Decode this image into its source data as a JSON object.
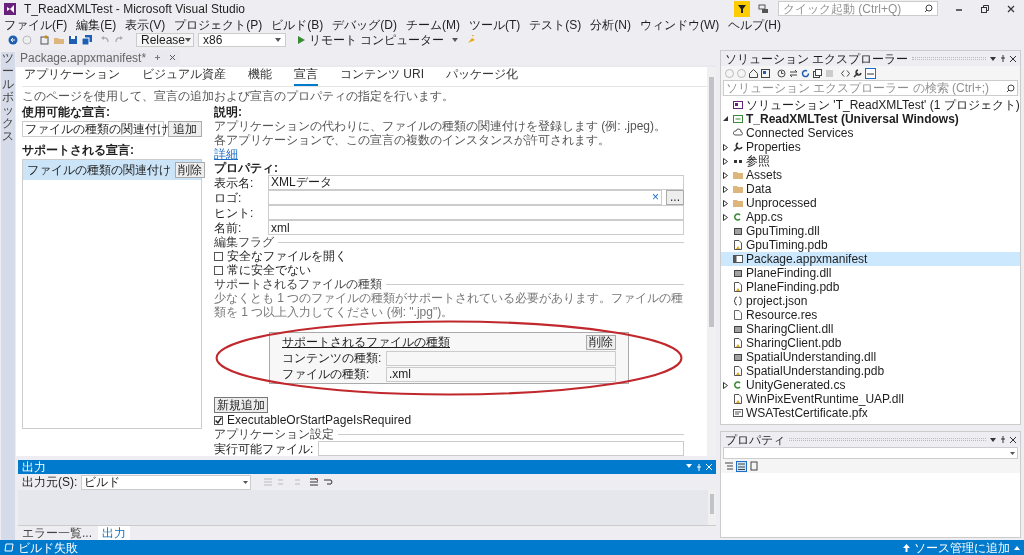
{
  "window": {
    "title": "T_ReadXMLTest - Microsoft Visual Studio",
    "quick_launch": {
      "placeholder": "クイック起動 (Ctrl+Q)"
    }
  },
  "menu": [
    "ファイル(F)",
    "編集(E)",
    "表示(V)",
    "プロジェクト(P)",
    "ビルド(B)",
    "デバッグ(D)",
    "チーム(M)",
    "ツール(T)",
    "テスト(S)",
    "分析(N)",
    "ウィンドウ(W)",
    "ヘルプ(H)"
  ],
  "toolbar": {
    "configuration": "Release",
    "platform": "x86",
    "run_target": "リモート コンピューター"
  },
  "toolbox_tab": "ツールボックス",
  "document_tab": {
    "title": "Package.appxmanifest*"
  },
  "manifest_tabs": [
    {
      "label": "アプリケーション",
      "selected": false
    },
    {
      "label": "ビジュアル資産",
      "selected": false
    },
    {
      "label": "機能",
      "selected": false
    },
    {
      "label": "宣言",
      "selected": true
    },
    {
      "label": "コンテンツ URI",
      "selected": false
    },
    {
      "label": "パッケージ化",
      "selected": false
    }
  ],
  "page_description": "このページを使用して、宣言の追加および宣言のプロパティの指定を行います。",
  "available": {
    "label": "使用可能な宣言:",
    "value": "ファイルの種類の関連付け",
    "button": "追加"
  },
  "supported": {
    "label": "サポートされる宣言:",
    "items": [
      {
        "label": "ファイルの種類の関連付け",
        "button": "削除",
        "selected": true
      }
    ]
  },
  "description": {
    "heading": "説明:",
    "lines": [
      "アプリケーションの代わりに、ファイルの種類の関連付けを登録します (例: .jpeg)。",
      "各アプリケーションで、この宣言の複数のインスタンスが許可されます。"
    ],
    "link": "詳細"
  },
  "properties": {
    "heading": "プロパティ:",
    "fields": [
      {
        "label": "表示名:",
        "value": "XMLデータ",
        "kind": "text"
      },
      {
        "label": "ロゴ:",
        "kind": "file",
        "clear": "×",
        "browse": "..."
      },
      {
        "label": "ヒント:",
        "kind": "text"
      },
      {
        "label": "名前:",
        "value": "xml",
        "kind": "text"
      }
    ]
  },
  "edit_flags": {
    "heading": "編集フラグ",
    "options": [
      {
        "label": "安全なファイルを開く",
        "checked": false
      },
      {
        "label": "常に安全でない",
        "checked": false
      }
    ]
  },
  "file_types": {
    "heading": "サポートされるファイルの種類",
    "note": "少なくとも 1 つのファイルの種類がサポートされている必要があります。ファイルの種類を 1 つ以上入力してください (例: \".jpg\")。",
    "entry": {
      "title": "サポートされるファイルの種類",
      "remove": "削除",
      "fields": [
        {
          "label": "コンテンツの種類:"
        },
        {
          "label": "ファイルの種類:",
          "value": ".xml"
        }
      ]
    },
    "add_button": "新規追加"
  },
  "startpage_option": {
    "label": "ExecutableOrStartPageIsRequired",
    "checked": true
  },
  "app_settings": {
    "heading": "アプリケーション設定",
    "fields": [
      {
        "label": "実行可能ファイル:"
      }
    ]
  },
  "output": {
    "title": "出力",
    "source_label": "出力元(S):",
    "source": "ビルド",
    "tabs": [
      {
        "label": "エラー一覧...",
        "selected": false
      },
      {
        "label": "出力",
        "selected": true
      }
    ]
  },
  "solution_explorer": {
    "title": "ソリューション エクスプローラー",
    "search": {
      "placeholder": "ソリューション エクスプローラー の検索 (Ctrl+;)"
    },
    "tree": [
      {
        "label": "ソリューション 'T_ReadXMLTest' (1 プロジェクト)",
        "kind": "solution",
        "selected": false,
        "children": [
          {
            "label": "T_ReadXMLTest (Universal Windows)",
            "kind": "project",
            "expanded": true,
            "selected": false,
            "children": [
              {
                "label": "Connected Services",
                "kind": "cloud",
                "selected": false
              },
              {
                "label": "Properties",
                "kind": "wrench",
                "expanded": false,
                "selected": false
              },
              {
                "label": "参照",
                "kind": "references",
                "expanded": false,
                "selected": false
              },
              {
                "label": "Assets",
                "kind": "folder",
                "expanded": false,
                "selected": false
              },
              {
                "label": "Data",
                "kind": "folder",
                "expanded": false,
                "selected": false
              },
              {
                "label": "Unprocessed",
                "kind": "folder",
                "expanded": false,
                "selected": false
              },
              {
                "label": "App.cs",
                "kind": "csharp",
                "expanded": false,
                "selected": false
              },
              {
                "label": "GpuTiming.dll",
                "kind": "dll",
                "selected": false
              },
              {
                "label": "GpuTiming.pdb",
                "kind": "pdb",
                "selected": false
              },
              {
                "label": "Package.appxmanifest",
                "kind": "manifest",
                "selected": true
              },
              {
                "label": "PlaneFinding.dll",
                "kind": "dll",
                "selected": false
              },
              {
                "label": "PlaneFinding.pdb",
                "kind": "pdb",
                "selected": false
              },
              {
                "label": "project.json",
                "kind": "json",
                "selected": false
              },
              {
                "label": "Resource.res",
                "kind": "file",
                "selected": false
              },
              {
                "label": "SharingClient.dll",
                "kind": "dll",
                "selected": false
              },
              {
                "label": "SharingClient.pdb",
                "kind": "pdb",
                "selected": false
              },
              {
                "label": "SpatialUnderstanding.dll",
                "kind": "dll",
                "selected": false
              },
              {
                "label": "SpatialUnderstanding.pdb",
                "kind": "pdb",
                "selected": false
              },
              {
                "label": "UnityGenerated.cs",
                "kind": "csharp",
                "expanded": false,
                "selected": false
              },
              {
                "label": "WinPixEventRuntime_UAP.dll",
                "kind": "pdb",
                "selected": false
              },
              {
                "label": "WSATestCertificate.pfx",
                "kind": "certificate",
                "selected": false
              }
            ]
          }
        ]
      }
    ]
  },
  "properties_panel": {
    "title": "プロパティ"
  },
  "status_bar": {
    "message": "ビルド失敗",
    "source_control": "ソース管理に追加"
  }
}
